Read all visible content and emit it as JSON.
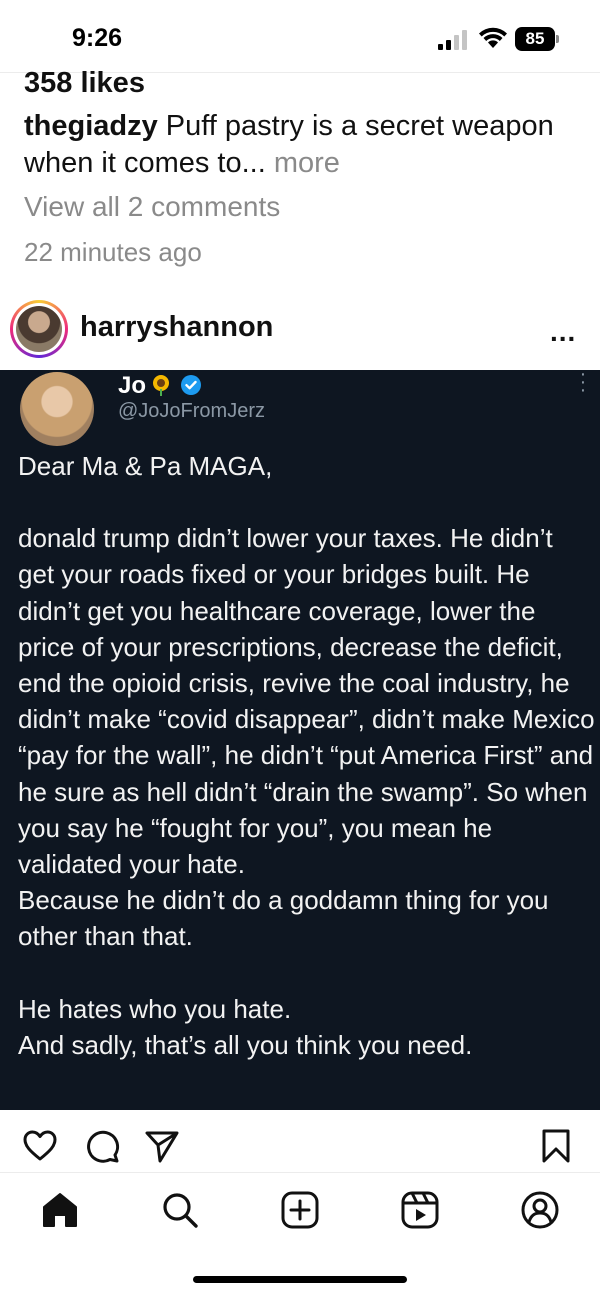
{
  "status_bar": {
    "time": "9:26",
    "battery": "85"
  },
  "previous_post": {
    "likes": "358 likes",
    "caption_user": "thegiadzy",
    "caption_text": " Puff pastry is a secret weapon when it comes to...",
    "caption_more": " more",
    "view_comments": "View all 2 comments",
    "time_ago": "22 minutes ago"
  },
  "post": {
    "username": "harryshannon",
    "more_label": "...",
    "tweet": {
      "name": "Jo",
      "handle": "@JoJoFromJerz",
      "lines": [
        "Dear Ma & Pa MAGA,",
        "",
        "donald trump didn’t lower your taxes. He didn’t get your roads fixed or your bridges built. He didn’t get you healthcare coverage, lower the price of your prescriptions, decrease the deficit, end the opioid crisis, revive the coal industry, he didn’t make “covid disappear”, didn’t make Mexico “pay for the wall”, he didn’t “put America First” and he sure as hell didn’t “drain the swamp”. So when you say he “fought for you”, you mean he validated your hate.",
        "Because he didn’t do a goddamn thing for you other than that.",
        "",
        "He hates who you hate.",
        "And sadly, that’s all you think you need."
      ]
    }
  },
  "actions": {
    "icons": [
      "heart-icon",
      "comment-icon",
      "share-icon",
      "bookmark-icon"
    ]
  },
  "nav": {
    "icons": [
      "home-icon",
      "search-icon",
      "create-icon",
      "reels-icon",
      "profile-icon"
    ]
  },
  "colors": {
    "tweet_bg": "#0e1621",
    "muted_text": "#8a8a8a",
    "verified_blue": "#1d9bf0",
    "handle_gray": "#8b98a5"
  }
}
